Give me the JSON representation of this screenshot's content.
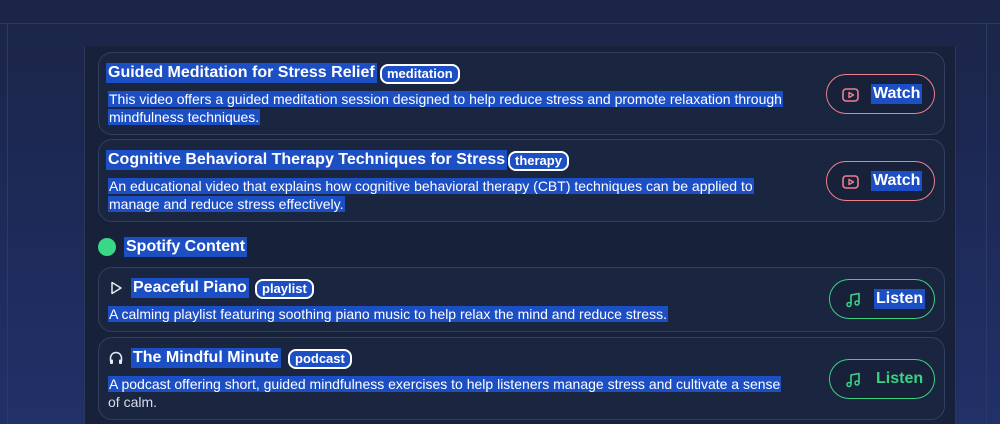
{
  "youtube": {
    "items": [
      {
        "title": "Guided Meditation for Stress Relief",
        "tag": "meditation",
        "description_lines": [
          "This video offers a guided meditation session designed to help reduce stress and promote relaxation through",
          "mindfulness techniques."
        ],
        "action_label": "Watch",
        "icon": "play-video-icon"
      },
      {
        "title": "Cognitive Behavioral Therapy Techniques for Stress",
        "tag": "therapy",
        "description_lines": [
          "An educational video that explains how cognitive behavioral therapy (CBT) techniques can be applied to",
          "manage and reduce stress effectively."
        ],
        "action_label": "Watch",
        "icon": "play-video-icon"
      }
    ]
  },
  "spotify": {
    "section_title": "Spotify Content",
    "items": [
      {
        "title": "Peaceful Piano",
        "tag": "playlist",
        "description_lines": [
          "A calming playlist featuring soothing piano music to help relax the mind and reduce stress."
        ],
        "action_label": "Listen",
        "lead_icon": "play-triangle-icon",
        "icon": "music-note-icon"
      },
      {
        "title": "The Mindful Minute",
        "tag": "podcast",
        "description_lines": [
          "A podcast offering short, guided mindfulness exercises to help listeners manage stress and cultivate a sense",
          "of calm."
        ],
        "action_label": "Listen",
        "lead_icon": "headphones-icon",
        "icon": "music-note-icon"
      }
    ]
  },
  "colors": {
    "youtube_accent": "#f07f8c",
    "spotify_accent": "#3bd183",
    "selection": "#1d4fc4"
  }
}
